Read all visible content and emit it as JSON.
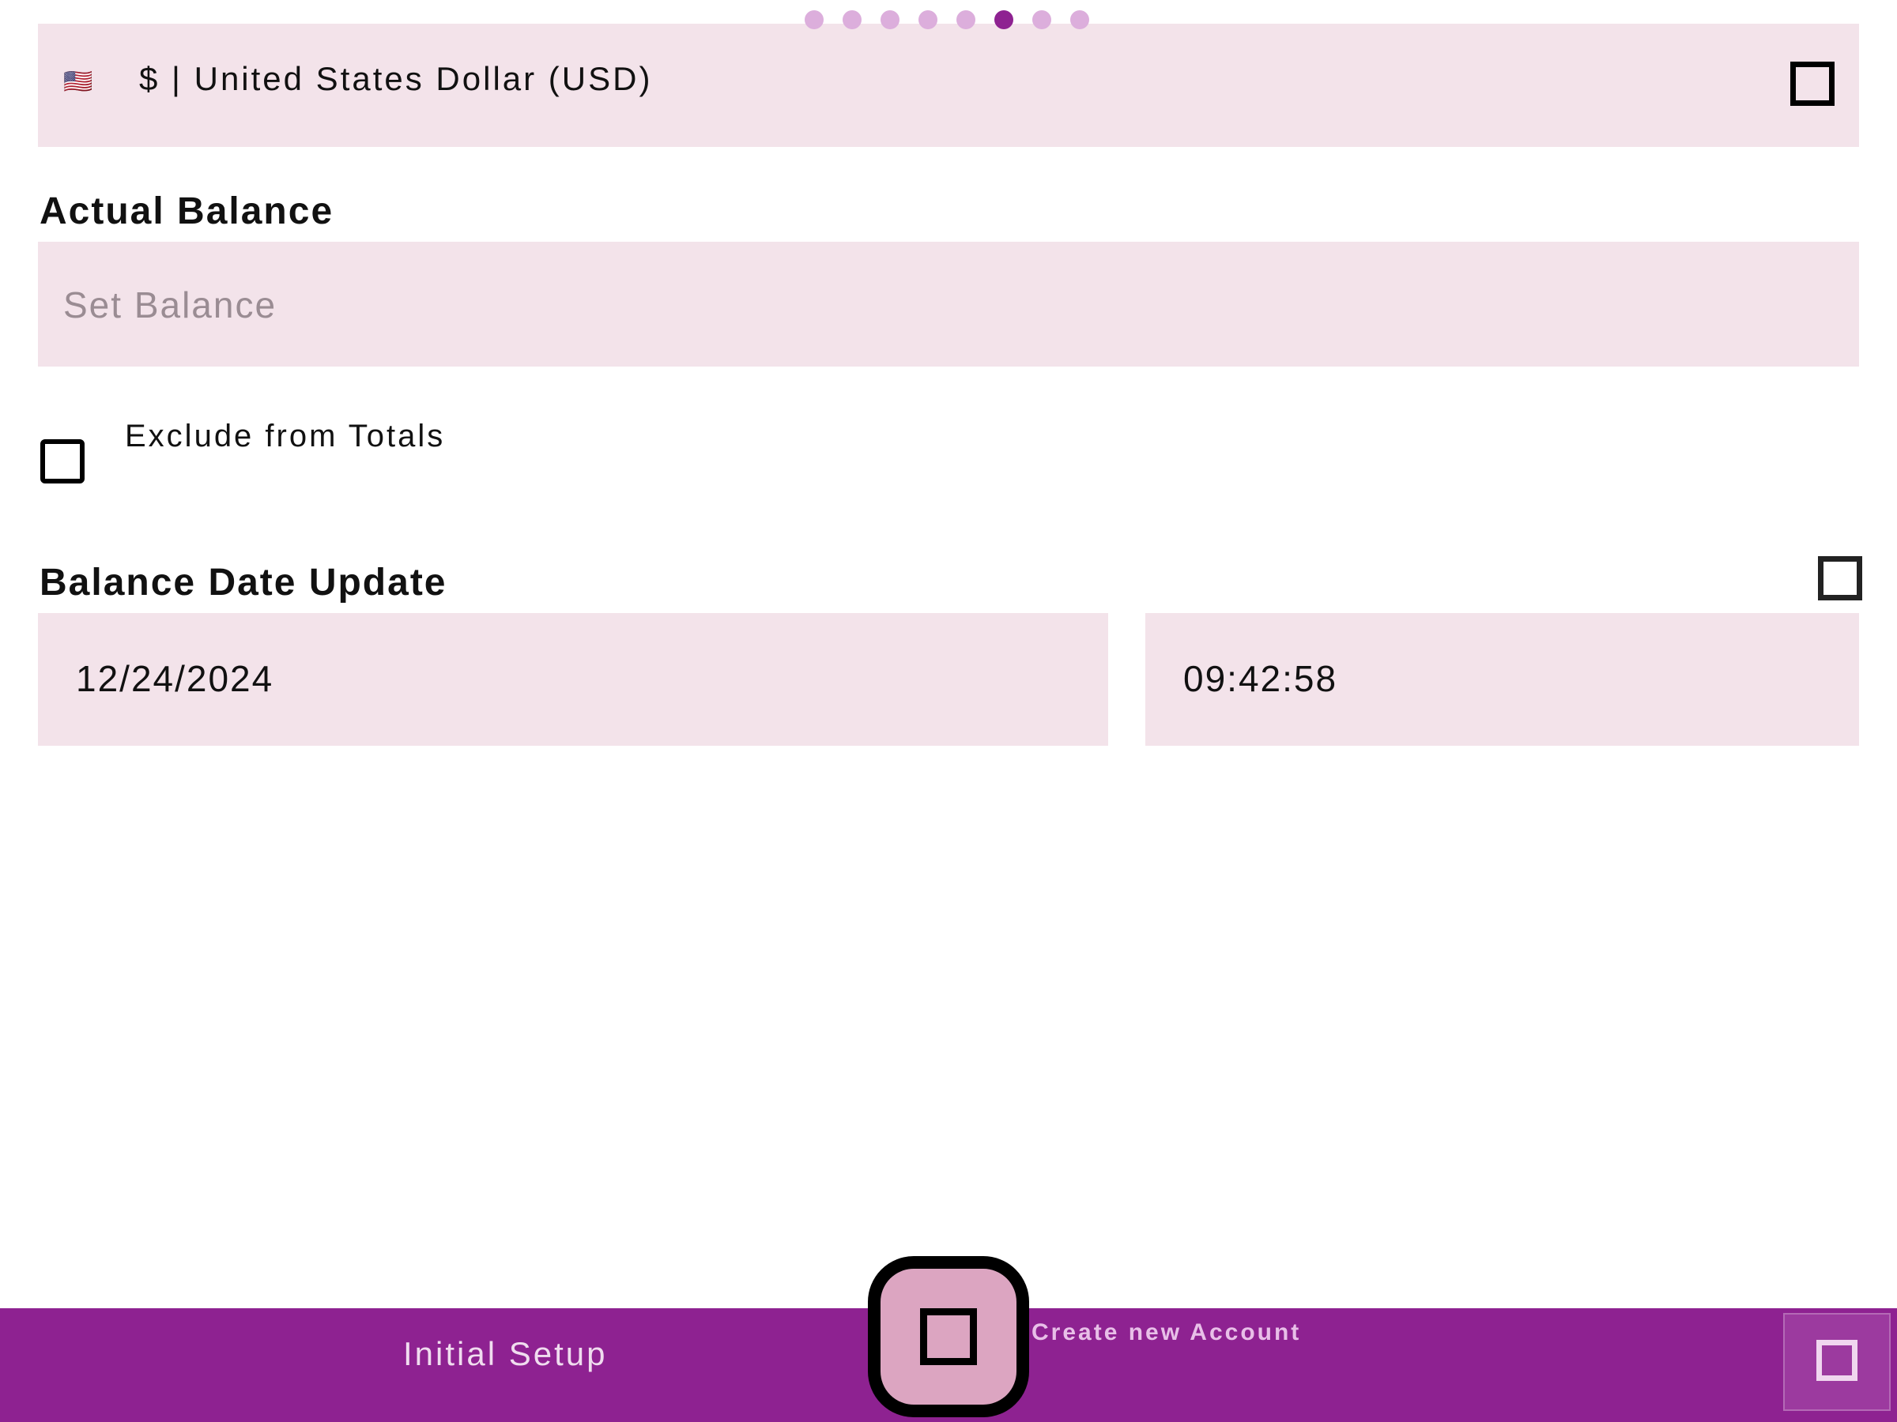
{
  "pager": {
    "total": 8,
    "active_index": 5
  },
  "currency": {
    "flag_glyph": "🇺🇸",
    "label": "$ | United States Dollar (USD)",
    "dropdown_icon": "square-icon"
  },
  "balance": {
    "heading": "Actual Balance",
    "value": "",
    "placeholder": "Set Balance"
  },
  "exclude": {
    "label": "Exclude from Totals",
    "checked": false
  },
  "balance_date": {
    "heading": "Balance Date Update",
    "reset_icon": "square-icon",
    "date": "12/24/2024",
    "time": "09:42:58"
  },
  "bottom_bar": {
    "left_label": "Initial Setup",
    "center_label": "Create new Account",
    "fab_icon": "square-icon",
    "corner_icon": "square-icon"
  },
  "colors": {
    "accent": "#8e2291",
    "field_background": "#f3e3ea",
    "dot_inactive": "#dcaedc",
    "fab_background": "#dca5c1"
  }
}
